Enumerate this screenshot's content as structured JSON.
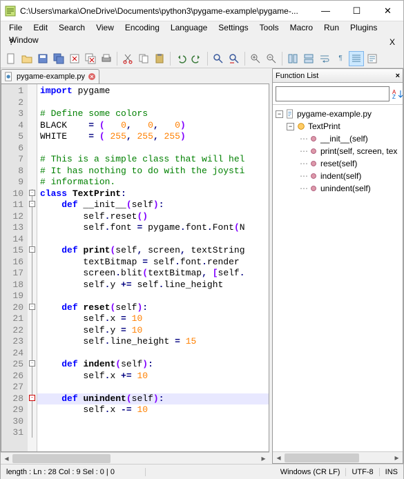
{
  "titlebar": {
    "path": "C:\\Users\\marka\\OneDrive\\Documents\\python3\\pygame-example\\pygame-..."
  },
  "menu": [
    "File",
    "Edit",
    "Search",
    "View",
    "Encoding",
    "Language",
    "Settings",
    "Tools",
    "Macro",
    "Run",
    "Plugins",
    "Window"
  ],
  "menu2": [
    "?",
    "X"
  ],
  "tab": {
    "name": "pygame-example.py"
  },
  "code": {
    "lines": [
      {
        "n": 1,
        "seg": [
          [
            "kw",
            "import"
          ],
          [
            "",
            " pygame"
          ]
        ]
      },
      {
        "n": 2,
        "seg": []
      },
      {
        "n": 3,
        "seg": [
          [
            "cm",
            "# Define some colors"
          ]
        ]
      },
      {
        "n": 4,
        "seg": [
          [
            "",
            "BLACK    "
          ],
          [
            "op",
            "="
          ],
          [
            "",
            " "
          ],
          [
            "paren",
            "("
          ],
          [
            "",
            "   "
          ],
          [
            "num",
            "0"
          ],
          [
            "op",
            ","
          ],
          [
            "",
            "   "
          ],
          [
            "num",
            "0"
          ],
          [
            "op",
            ","
          ],
          [
            "",
            "   "
          ],
          [
            "num",
            "0"
          ],
          [
            "paren",
            ")"
          ]
        ]
      },
      {
        "n": 5,
        "seg": [
          [
            "",
            "WHITE    "
          ],
          [
            "op",
            "="
          ],
          [
            "",
            " "
          ],
          [
            "paren",
            "("
          ],
          [
            "",
            " "
          ],
          [
            "num",
            "255"
          ],
          [
            "op",
            ","
          ],
          [
            "",
            " "
          ],
          [
            "num",
            "255"
          ],
          [
            "op",
            ","
          ],
          [
            "",
            " "
          ],
          [
            "num",
            "255"
          ],
          [
            "paren",
            ")"
          ]
        ]
      },
      {
        "n": 6,
        "seg": []
      },
      {
        "n": 7,
        "seg": [
          [
            "cm",
            "# This is a simple class that will hel"
          ]
        ]
      },
      {
        "n": 8,
        "seg": [
          [
            "cm",
            "# It has nothing to do with the joysti"
          ]
        ]
      },
      {
        "n": 9,
        "seg": [
          [
            "cm",
            "# information."
          ]
        ]
      },
      {
        "n": 10,
        "seg": [
          [
            "kw",
            "class"
          ],
          [
            "",
            " "
          ],
          [
            "deffn",
            "TextPrint"
          ],
          [
            "op",
            ":"
          ]
        ]
      },
      {
        "n": 11,
        "seg": [
          [
            "",
            "    "
          ],
          [
            "kw",
            "def"
          ],
          [
            "",
            " __init__"
          ],
          [
            "paren",
            "("
          ],
          [
            "",
            "self"
          ],
          [
            "paren",
            ")"
          ],
          [
            "op",
            ":"
          ]
        ]
      },
      {
        "n": 12,
        "seg": [
          [
            "",
            "        self"
          ],
          [
            "op",
            "."
          ],
          [
            "",
            "reset"
          ],
          [
            "paren",
            "()"
          ]
        ]
      },
      {
        "n": 13,
        "seg": [
          [
            "",
            "        self"
          ],
          [
            "op",
            "."
          ],
          [
            "",
            "font "
          ],
          [
            "op",
            "="
          ],
          [
            "",
            " pygame"
          ],
          [
            "op",
            "."
          ],
          [
            "",
            "font"
          ],
          [
            "op",
            "."
          ],
          [
            "",
            "Font"
          ],
          [
            "paren",
            "("
          ],
          [
            "",
            "N"
          ]
        ]
      },
      {
        "n": 14,
        "seg": []
      },
      {
        "n": 15,
        "seg": [
          [
            "",
            "    "
          ],
          [
            "kw",
            "def"
          ],
          [
            "",
            " "
          ],
          [
            "deffn",
            "print"
          ],
          [
            "paren",
            "("
          ],
          [
            "",
            "self"
          ],
          [
            "op",
            ","
          ],
          [
            "",
            " screen"
          ],
          [
            "op",
            ","
          ],
          [
            "",
            " textString"
          ]
        ]
      },
      {
        "n": 16,
        "seg": [
          [
            "",
            "        textBitmap "
          ],
          [
            "op",
            "="
          ],
          [
            "",
            " self"
          ],
          [
            "op",
            "."
          ],
          [
            "",
            "font"
          ],
          [
            "op",
            "."
          ],
          [
            "",
            "render"
          ]
        ]
      },
      {
        "n": 17,
        "seg": [
          [
            "",
            "        screen"
          ],
          [
            "op",
            "."
          ],
          [
            "",
            "blit"
          ],
          [
            "paren",
            "("
          ],
          [
            "",
            "textBitmap"
          ],
          [
            "op",
            ","
          ],
          [
            "",
            " "
          ],
          [
            "paren",
            "["
          ],
          [
            "",
            "self"
          ],
          [
            "op",
            "."
          ]
        ]
      },
      {
        "n": 18,
        "seg": [
          [
            "",
            "        self"
          ],
          [
            "op",
            "."
          ],
          [
            "",
            "y "
          ],
          [
            "op",
            "+="
          ],
          [
            "",
            " self"
          ],
          [
            "op",
            "."
          ],
          [
            "",
            "line_height"
          ]
        ]
      },
      {
        "n": 19,
        "seg": []
      },
      {
        "n": 20,
        "seg": [
          [
            "",
            "    "
          ],
          [
            "kw",
            "def"
          ],
          [
            "",
            " "
          ],
          [
            "deffn",
            "reset"
          ],
          [
            "paren",
            "("
          ],
          [
            "",
            "self"
          ],
          [
            "paren",
            ")"
          ],
          [
            "op",
            ":"
          ]
        ]
      },
      {
        "n": 21,
        "seg": [
          [
            "",
            "        self"
          ],
          [
            "op",
            "."
          ],
          [
            "",
            "x "
          ],
          [
            "op",
            "="
          ],
          [
            "",
            " "
          ],
          [
            "num",
            "10"
          ]
        ]
      },
      {
        "n": 22,
        "seg": [
          [
            "",
            "        self"
          ],
          [
            "op",
            "."
          ],
          [
            "",
            "y "
          ],
          [
            "op",
            "="
          ],
          [
            "",
            " "
          ],
          [
            "num",
            "10"
          ]
        ]
      },
      {
        "n": 23,
        "seg": [
          [
            "",
            "        self"
          ],
          [
            "op",
            "."
          ],
          [
            "",
            "line_height "
          ],
          [
            "op",
            "="
          ],
          [
            "",
            " "
          ],
          [
            "num",
            "15"
          ]
        ]
      },
      {
        "n": 24,
        "seg": []
      },
      {
        "n": 25,
        "seg": [
          [
            "",
            "    "
          ],
          [
            "kw",
            "def"
          ],
          [
            "",
            " "
          ],
          [
            "deffn",
            "indent"
          ],
          [
            "paren",
            "("
          ],
          [
            "",
            "self"
          ],
          [
            "paren",
            ")"
          ],
          [
            "op",
            ":"
          ]
        ]
      },
      {
        "n": 26,
        "seg": [
          [
            "",
            "        self"
          ],
          [
            "op",
            "."
          ],
          [
            "",
            "x "
          ],
          [
            "op",
            "+="
          ],
          [
            "",
            " "
          ],
          [
            "num",
            "10"
          ]
        ]
      },
      {
        "n": 27,
        "seg": []
      },
      {
        "n": 28,
        "hl": true,
        "seg": [
          [
            "",
            "    "
          ],
          [
            "kw",
            "def"
          ],
          [
            "",
            " "
          ],
          [
            "deffn",
            "unindent"
          ],
          [
            "paren",
            "("
          ],
          [
            "",
            "self"
          ],
          [
            "paren",
            ")"
          ],
          [
            "op",
            ":"
          ]
        ]
      },
      {
        "n": 29,
        "seg": [
          [
            "",
            "        self"
          ],
          [
            "op",
            "."
          ],
          [
            "",
            "x "
          ],
          [
            "op",
            "-="
          ],
          [
            "",
            " "
          ],
          [
            "num",
            "10"
          ]
        ]
      },
      {
        "n": 30,
        "seg": []
      },
      {
        "n": 31,
        "seg": []
      }
    ]
  },
  "folds": [
    {
      "type": "box",
      "line": 10,
      "sym": "-"
    },
    {
      "type": "box",
      "line": 11,
      "sym": "-"
    },
    {
      "type": "box",
      "line": 15,
      "sym": "-"
    },
    {
      "type": "box",
      "line": 20,
      "sym": "-"
    },
    {
      "type": "box",
      "line": 25,
      "sym": "-"
    },
    {
      "type": "box",
      "line": 28,
      "sym": "-",
      "red": true
    }
  ],
  "funclist": {
    "title": "Function List",
    "root": "pygame-example.py",
    "class": "TextPrint",
    "methods": [
      "__init__(self)",
      "print(self, screen, tex",
      "reset(self)",
      "indent(self)",
      "unindent(self)"
    ]
  },
  "status": {
    "length": "length :    Ln : 28    Col : 9    Sel : 0 | 0",
    "eol": "Windows (CR LF)",
    "enc": "UTF-8",
    "mode": "INS"
  }
}
